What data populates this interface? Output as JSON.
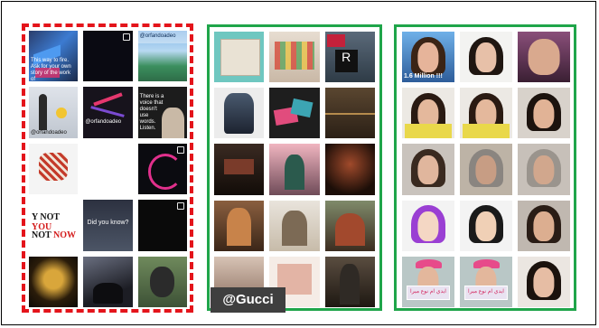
{
  "left_panel": {
    "cells": [
      {
        "caption": "This way to fire. Ask for your own story of the work of"
      },
      {
        "caption": ""
      },
      {
        "caption": "@orfandoadeo"
      },
      {
        "caption": "@orfandoadeo"
      },
      {
        "caption": "@orfandoadeo"
      },
      {
        "caption": "There is a voice that doesn't use words. Listen."
      },
      {
        "caption": ""
      },
      {
        "caption": ""
      },
      {
        "caption": ""
      },
      {
        "caption": "Y NOT YOU"
      },
      {
        "caption": "Did you know?"
      },
      {
        "caption": ""
      },
      {
        "caption": ""
      },
      {
        "caption": ""
      },
      {
        "caption": ""
      }
    ],
    "text_tiles": {
      "line1_a": "Y NOT ",
      "line1_b": "YOU",
      "line2_a": "NOT ",
      "line2_b": "NOW",
      "did_you_know": "Did you know?"
    }
  },
  "mid_panel": {
    "watermark": "@Gucci"
  },
  "right_panel": {
    "million_label": "1.6 Million !!!",
    "arabic_banner": "ايدي ام نوع ميرا",
    "arabic_sub": "اسم الادوات"
  },
  "colors": {
    "dashed_border": "#e4141b",
    "green_border": "#1fa54a"
  }
}
